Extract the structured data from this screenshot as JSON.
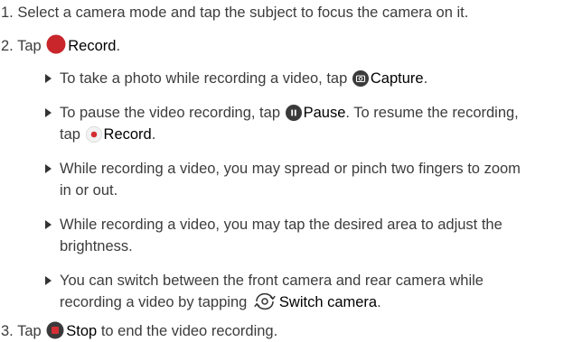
{
  "instructions": {
    "step1": {
      "number": "1.",
      "text": "Select a camera mode and tap the subject to focus the camera on it."
    },
    "step2": {
      "number": "2.",
      "prefix": "Tap",
      "record_label": "Record",
      "record_icon": "record-icon",
      "record_color": "#c8262b",
      "tail": "."
    },
    "bullets": [
      {
        "line1_before": "To take a photo while recording a video, tap",
        "capture_icon": "camera-capture-icon",
        "capture_label": "Capture",
        "line1_after": "."
      },
      {
        "line1_before": "To pause the video recording, tap",
        "pause_icon": "pause-icon",
        "pause_label": "Pause",
        "line1_after": ". To resume the recording,",
        "line2_before": "tap",
        "record_icon": "record-small-icon",
        "record_label": "Record",
        "line2_after": "."
      },
      {
        "line1": "While recording a video, you may spread or pinch two fingers to zoom",
        "line2": "in or out."
      },
      {
        "line1": "While recording a video, you may tap the desired area to adjust the",
        "line2": "brightness."
      },
      {
        "line1": "You can switch between the front camera and rear camera while",
        "line2_before": "recording a video by tapping",
        "switch_icon": "switch-camera-icon",
        "switch_label": "Switch camera",
        "line2_after": "."
      }
    ],
    "step3": {
      "number": "3.",
      "prefix": "Tap",
      "stop_icon": "stop-icon",
      "stop_label": "Stop",
      "suffix": "to end the video recording."
    }
  },
  "colors": {
    "text": "#3c3c3c",
    "emphasis": "#000000",
    "record_red": "#c8262b",
    "icon_dark": "#333333"
  }
}
